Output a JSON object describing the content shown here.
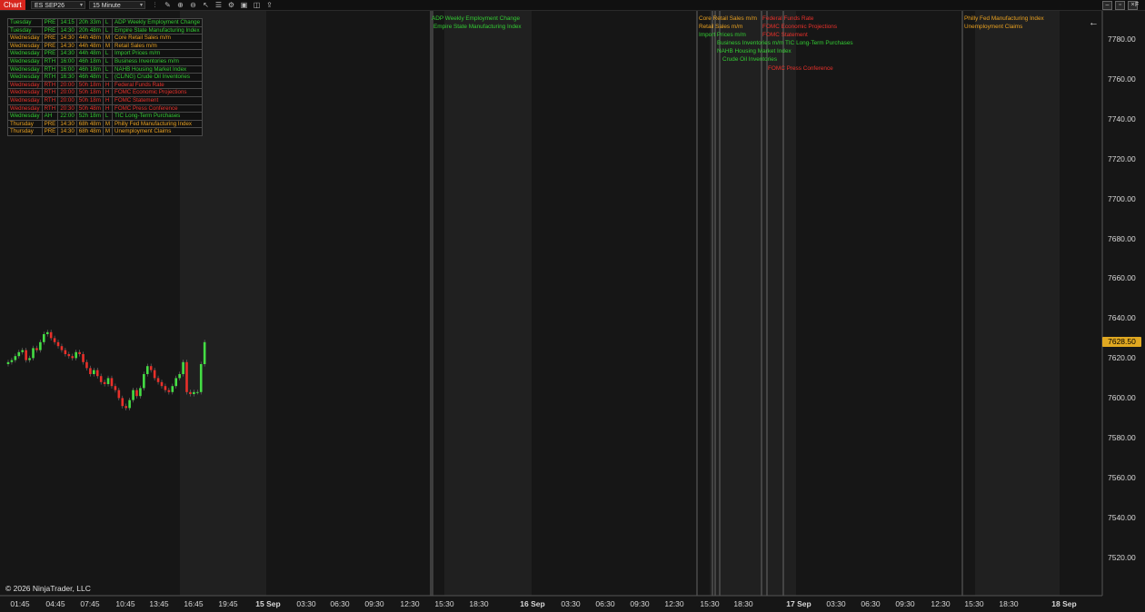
{
  "toolbar": {
    "tab": "Chart",
    "instrument": "ES SEP26",
    "interval": "15 Minute",
    "icons": [
      "bars-icon",
      "draw-icon",
      "zoom-in-icon",
      "zoom-out-icon",
      "pointer-icon",
      "properties-icon",
      "strategies-icon",
      "templates-icon",
      "screenshot-icon",
      "share-icon"
    ],
    "axis_flag": "F"
  },
  "events": [
    {
      "day": "Tuesday",
      "session": "PRE",
      "time": "14:15",
      "eta": "20h 33m",
      "impact": "L",
      "name": "ADP Weekly Employment Change",
      "color": "#33cc33"
    },
    {
      "day": "Tuesday",
      "session": "PRE",
      "time": "14:30",
      "eta": "20h 48m",
      "impact": "L",
      "name": "Empire State Manufacturing Index",
      "color": "#33cc33"
    },
    {
      "day": "Wednesday",
      "session": "PRE",
      "time": "14:30",
      "eta": "44h 48m",
      "impact": "M",
      "name": "Core Retail Sales m/m",
      "color": "#e8a020"
    },
    {
      "day": "Wednesday",
      "session": "PRE",
      "time": "14:30",
      "eta": "44h 48m",
      "impact": "M",
      "name": "Retail Sales m/m",
      "color": "#e8a020"
    },
    {
      "day": "Wednesday",
      "session": "PRE",
      "time": "14:30",
      "eta": "44h 48m",
      "impact": "L",
      "name": "Import Prices m/m",
      "color": "#33cc33"
    },
    {
      "day": "Wednesday",
      "session": "RTH",
      "time": "16:00",
      "eta": "46h 18m",
      "impact": "L",
      "name": "Business Inventories m/m",
      "color": "#33cc33"
    },
    {
      "day": "Wednesday",
      "session": "RTH",
      "time": "16:00",
      "eta": "46h 18m",
      "impact": "L",
      "name": "NAHB Housing Market Index",
      "color": "#33cc33"
    },
    {
      "day": "Wednesday",
      "session": "RTH",
      "time": "16:30",
      "eta": "46h 48m",
      "impact": "L",
      "name": "(CL/NG) Crude Oil Inventories",
      "color": "#33cc33"
    },
    {
      "day": "Wednesday",
      "session": "RTH",
      "time": "20:00",
      "eta": "50h 18m",
      "impact": "H",
      "name": "Federal Funds Rate",
      "color": "#e8302a"
    },
    {
      "day": "Wednesday",
      "session": "RTH",
      "time": "20:00",
      "eta": "50h 18m",
      "impact": "H",
      "name": "FOMC Economic Projections",
      "color": "#e8302a"
    },
    {
      "day": "Wednesday",
      "session": "RTH",
      "time": "20:00",
      "eta": "50h 18m",
      "impact": "H",
      "name": "FOMC Statement",
      "color": "#e8302a"
    },
    {
      "day": "Wednesday",
      "session": "RTH",
      "time": "20:30",
      "eta": "50h 48m",
      "impact": "H",
      "name": "FOMC Press Conference",
      "color": "#e8302a"
    },
    {
      "day": "Wednesday",
      "session": "AH",
      "time": "22:00",
      "eta": "52h 18m",
      "impact": "L",
      "name": "TIC Long-Term Purchases",
      "color": "#33cc33"
    },
    {
      "day": "Thursday",
      "session": "PRE",
      "time": "14:30",
      "eta": "68h 48m",
      "impact": "M",
      "name": "Philly Fed Manufacturing Index",
      "color": "#e8a020"
    },
    {
      "day": "Thursday",
      "session": "PRE",
      "time": "14:30",
      "eta": "68h 48m",
      "impact": "M",
      "name": "Unemployment Claims",
      "color": "#e8a020"
    }
  ],
  "chart_labels": [
    {
      "text": "ADP Weekly Employment Change",
      "color": "#33cc33"
    },
    {
      "text": "Empire State Manufacturing Index",
      "color": "#33cc33"
    },
    {
      "text": "Core Retail Sales m/m",
      "color": "#e8a020"
    },
    {
      "text": "Retail Sales m/m",
      "color": "#e8a020"
    },
    {
      "text": "Import Prices m/m",
      "color": "#33cc33"
    },
    {
      "text": "Business Inventories m/m",
      "color": "#33cc33"
    },
    {
      "text": "NAHB Housing Market Index",
      "color": "#33cc33"
    },
    {
      "text": "Crude Oil Inventories",
      "color": "#33cc33"
    },
    {
      "text": "Federal Funds Rate",
      "color": "#e8302a"
    },
    {
      "text": "FOMC Economic Projections",
      "color": "#e8302a"
    },
    {
      "text": "FOMC Statement",
      "color": "#e8302a"
    },
    {
      "text": "FOMC Press Conference",
      "color": "#e8302a"
    },
    {
      "text": "TIC Long-Term Purchases",
      "color": "#33cc33"
    },
    {
      "text": "Philly Fed Manufacturing Index",
      "color": "#e8a020"
    },
    {
      "text": "Unemployment Claims",
      "color": "#e8a020"
    }
  ],
  "chart_data": {
    "type": "candlestick",
    "instrument": "ES SEP26",
    "interval": "15 Minute",
    "ylim": [
      7500,
      7800
    ],
    "y_ticks": [
      "7780.00",
      "7760.00",
      "7740.00",
      "7720.00",
      "7700.00",
      "7680.00",
      "7660.00",
      "7640.00",
      "7620.00",
      "7600.00",
      "7580.00",
      "7560.00",
      "7540.00",
      "7520.00"
    ],
    "x_ticks": [
      "01:45",
      "04:45",
      "07:45",
      "10:45",
      "13:45",
      "16:45",
      "19:45",
      "15 Sep",
      "03:30",
      "06:30",
      "09:30",
      "12:30",
      "15:30",
      "18:30",
      "16 Sep",
      "03:30",
      "06:30",
      "09:30",
      "12:30",
      "15:30",
      "18:30",
      "17 Sep",
      "03:30",
      "06:30",
      "09:30",
      "12:30",
      "15:30",
      "18:30",
      "18 Sep"
    ],
    "last_price": "7628.50",
    "closes": [
      7618,
      7619,
      7621,
      7623,
      7624,
      7619,
      7620,
      7625,
      7624,
      7628,
      7632,
      7633,
      7630,
      7628,
      7626,
      7624,
      7622,
      7621,
      7620,
      7623,
      7622,
      7618,
      7615,
      7612,
      7614,
      7611,
      7608,
      7607,
      7610,
      7606,
      7604,
      7600,
      7596,
      7595,
      7599,
      7604,
      7601,
      7605,
      7612,
      7616,
      7614,
      7610,
      7608,
      7606,
      7604,
      7603,
      7606,
      7610,
      7612,
      7618,
      7603,
      7602,
      7603,
      7603,
      7617,
      7628
    ]
  },
  "copyright": "© 2026 NinjaTrader, LLC",
  "colors": {
    "up": "#44dd44",
    "down": "#e8302a",
    "grid": "#2a2a2a",
    "background": "#161616"
  }
}
